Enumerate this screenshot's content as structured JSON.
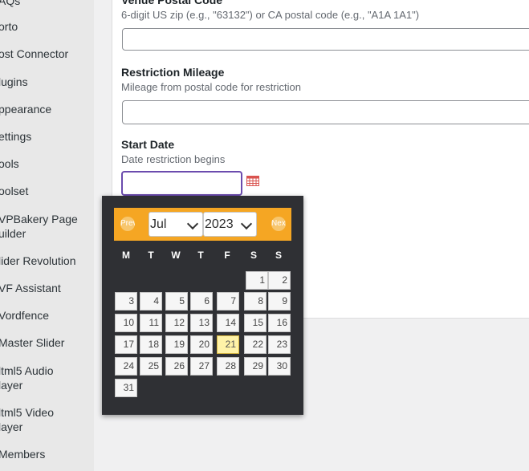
{
  "sidebar": {
    "items": [
      {
        "label": "AQs"
      },
      {
        "label": "orto"
      },
      {
        "label": "ost Connector"
      },
      {
        "label": "lugins"
      },
      {
        "label": "ppearance"
      },
      {
        "label": "ettings"
      },
      {
        "label": "ools"
      },
      {
        "label": "oolset"
      },
      {
        "label": "VPBakery Page",
        "label2": "uilder"
      },
      {
        "label": "lider Revolution"
      },
      {
        "label": "VF Assistant"
      },
      {
        "label": "Vordfence"
      },
      {
        "label": "Master Slider"
      },
      {
        "label": "ltml5 Audio",
        "label2": "layer"
      },
      {
        "label": "ltml5 Video",
        "label2": "layer"
      },
      {
        "label": "Members"
      }
    ]
  },
  "form": {
    "postal_title": "Venue Postal Code",
    "postal_desc": "6-digit US zip (e.g., \"63132\") or CA postal code (e.g., \"A1A 1A1\")",
    "mileage_title": "Restriction Mileage",
    "mileage_desc": "Mileage from postal code for restriction",
    "start_title": "Start Date",
    "start_desc": "Date restriction begins",
    "start_value": ""
  },
  "datepicker": {
    "prev_label": "Prev",
    "next_label": "Next",
    "month": "Jul",
    "year": "2023",
    "weekdays": [
      "M",
      "T",
      "W",
      "T",
      "F",
      "S",
      "S"
    ],
    "days": [
      "1",
      "2",
      "3",
      "4",
      "5",
      "6",
      "7",
      "8",
      "9",
      "10",
      "11",
      "12",
      "13",
      "14",
      "15",
      "16",
      "17",
      "18",
      "19",
      "20",
      "21",
      "22",
      "23",
      "24",
      "25",
      "26",
      "27",
      "28",
      "29",
      "30",
      "31"
    ],
    "today": "21",
    "colors": {
      "header": "#f5a623",
      "body": "#2f3034",
      "today": "#fff3a8"
    }
  }
}
